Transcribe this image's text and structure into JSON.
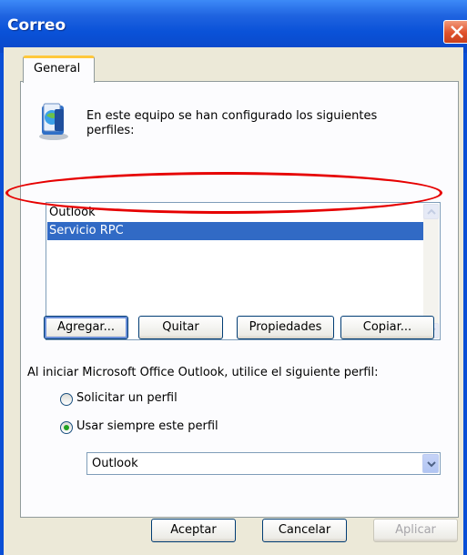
{
  "window": {
    "title": "Correo"
  },
  "tabs": [
    {
      "label": "General"
    }
  ],
  "description": {
    "line1": "En este equipo se han configurado los siguientes",
    "line2": "perfiles:"
  },
  "profiles": [
    {
      "label": "Outlook",
      "selected": false
    },
    {
      "label": "Servicio RPC",
      "selected": true
    }
  ],
  "profile_buttons": {
    "add": "Agregar...",
    "remove": "Quitar",
    "properties": "Propiedades",
    "copy": "Copiar..."
  },
  "startup": {
    "label": "Al iniciar Microsoft Office Outlook, utilice el siguiente perfil:",
    "prompt_option": "Solicitar un perfil",
    "always_option": "Usar siempre este perfil",
    "selected_option": "always",
    "profile_select_value": "Outlook"
  },
  "dialog_buttons": {
    "ok": "Aceptar",
    "cancel": "Cancelar",
    "apply": "Aplicar"
  },
  "colors": {
    "titlebar": "#0a52d8",
    "selection": "#316ac5",
    "annotation": "#e60000"
  }
}
